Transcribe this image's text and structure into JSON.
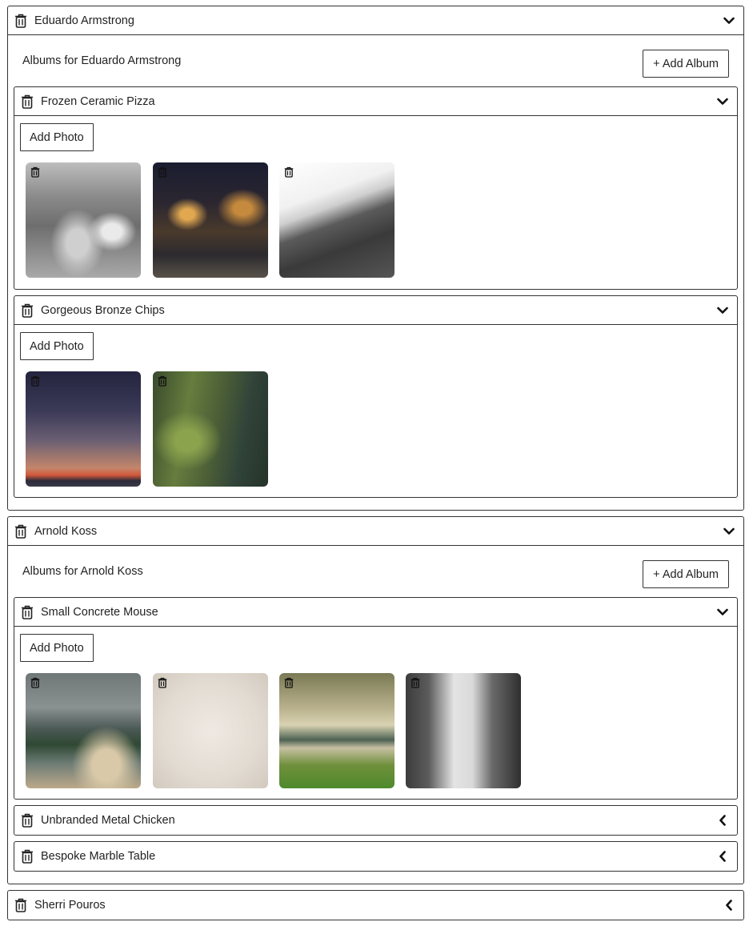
{
  "users": [
    {
      "name": "Eduardo Armstrong",
      "expanded": true,
      "albums_label": "Albums for Eduardo Armstrong",
      "add_album_label": "+ Add Album",
      "albums": [
        {
          "title": "Frozen Ceramic Pizza",
          "expanded": true,
          "add_photo_label": "Add Photo",
          "photos": [
            "grayscale-market-street",
            "night-street-lights",
            "mountain-above-clouds"
          ]
        },
        {
          "title": "Gorgeous Bronze Chips",
          "expanded": true,
          "add_photo_label": "Add Photo",
          "photos": [
            "sunset-horizon",
            "mossy-wall"
          ]
        }
      ]
    },
    {
      "name": "Arnold Koss",
      "expanded": true,
      "albums_label": "Albums for Arnold Koss",
      "add_album_label": "+ Add Album",
      "albums": [
        {
          "title": "Small Concrete Mouse",
          "expanded": true,
          "add_photo_label": "Add Photo",
          "photos": [
            "stormy-coast",
            "foggy-sky",
            "motion-blur-field",
            "blurred-trees"
          ]
        },
        {
          "title": "Unbranded Metal Chicken",
          "expanded": false
        },
        {
          "title": "Bespoke Marble Table",
          "expanded": false
        }
      ]
    },
    {
      "name": "Sherri Pouros",
      "expanded": false
    }
  ],
  "icons": {
    "delete": "trash-icon",
    "expanded": "chevron-down-icon",
    "collapsed": "chevron-left-icon"
  },
  "colors": {
    "border": "#333333",
    "text": "#222222",
    "background": "#ffffff"
  }
}
